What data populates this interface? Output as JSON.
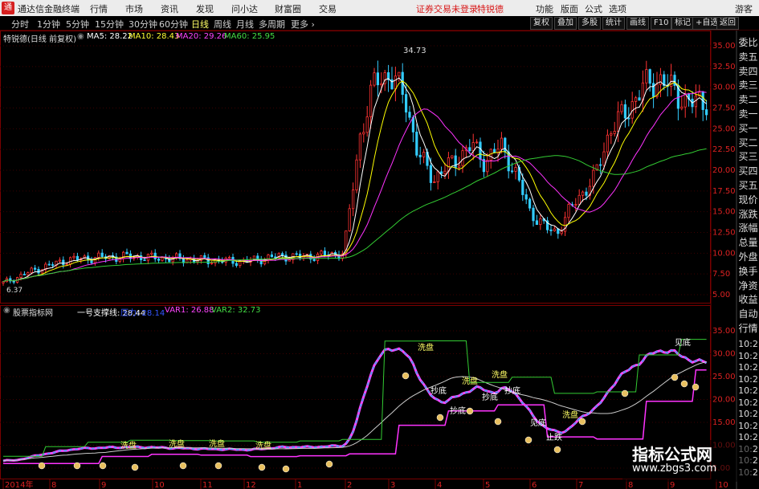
{
  "title_bar": {
    "app_title": "通达信金融终端",
    "logo_char": "通",
    "menu": [
      "行情",
      "市场",
      "资讯",
      "发现",
      "问小达",
      "财富圈",
      "交易"
    ],
    "login_status": "证券交易未登录",
    "stock_name": "特锐德",
    "right_menu": [
      "功能",
      "版面",
      "公式",
      "选项"
    ],
    "guest": "游客"
  },
  "toolbar": {
    "periods": [
      "分时",
      "1分钟",
      "5分钟",
      "15分钟",
      "30分钟",
      "60分钟",
      "日线",
      "周线",
      "月线",
      "多周期",
      "更多"
    ],
    "active_period": "日线",
    "right_buttons": [
      "复权",
      "叠加",
      "多股",
      "统计",
      "画线",
      "F10",
      "标记",
      "+自选",
      "返回"
    ]
  },
  "main_pane": {
    "stock_label": "特锐德(日线 前复权)",
    "ma5": "MA5: 28.22",
    "ma10": "MA10: 28.43",
    "ma20": "MA20: 29.26",
    "ma60": "MA60: 25.95",
    "peak_label": "34.73",
    "low_label": "6.37",
    "y_ticks": [
      "35.00",
      "32.50",
      "30.00",
      "27.50",
      "25.00",
      "22.50",
      "20.00",
      "17.50",
      "15.00",
      "12.50",
      "10.00",
      "7.50",
      "5.00"
    ],
    "colors": {
      "ma5": "#ffffff",
      "ma10": "#ffff00",
      "ma20": "#ff33ff",
      "ma60": "#33cc33",
      "up": "#ff3333",
      "down": "#33ccff"
    }
  },
  "indicator_pane": {
    "name": "股票指标网",
    "line1": "一号支撑线: 28.44",
    "line2": "压力: 28.14",
    "var1": "VAR1: 26.88",
    "var2": "VAR2: 32.73",
    "y_ticks": [
      "35.00",
      "30.00",
      "25.00",
      "20.00",
      "15.00",
      "10.00",
      "5.00"
    ],
    "labels": [
      "洗盘",
      "洗盘",
      "洗盘",
      "洗盘",
      "洗盘",
      "抄底",
      "抄底",
      "洗盘",
      "抄底",
      "洗盘",
      "抄底",
      "见底",
      "洗盘",
      "止跌",
      "见底"
    ]
  },
  "date_axis": [
    "2014年",
    "8",
    "9",
    "10",
    "11",
    "12",
    "1",
    "2",
    "3",
    "4",
    "5",
    "6",
    "7",
    "8",
    "9",
    "10"
  ],
  "side_panel": [
    "委比",
    "卖五",
    "卖四",
    "卖三",
    "卖二",
    "卖一",
    "买一",
    "买二",
    "买三",
    "买四",
    "买五",
    "现价",
    "涨跌",
    "涨幅",
    "总量",
    "外盘",
    "换手",
    "净资",
    "收益",
    "自动",
    "行情"
  ],
  "right_times": [
    "10:2",
    "10:2",
    "10:2",
    "10:2",
    "10:2",
    "10:2",
    "10:2",
    "10:2",
    "10:2",
    "10:2",
    "10:2",
    "10:2"
  ],
  "watermark": {
    "line1": "指标公式网",
    "line2": "www.zbgs3.com"
  }
}
